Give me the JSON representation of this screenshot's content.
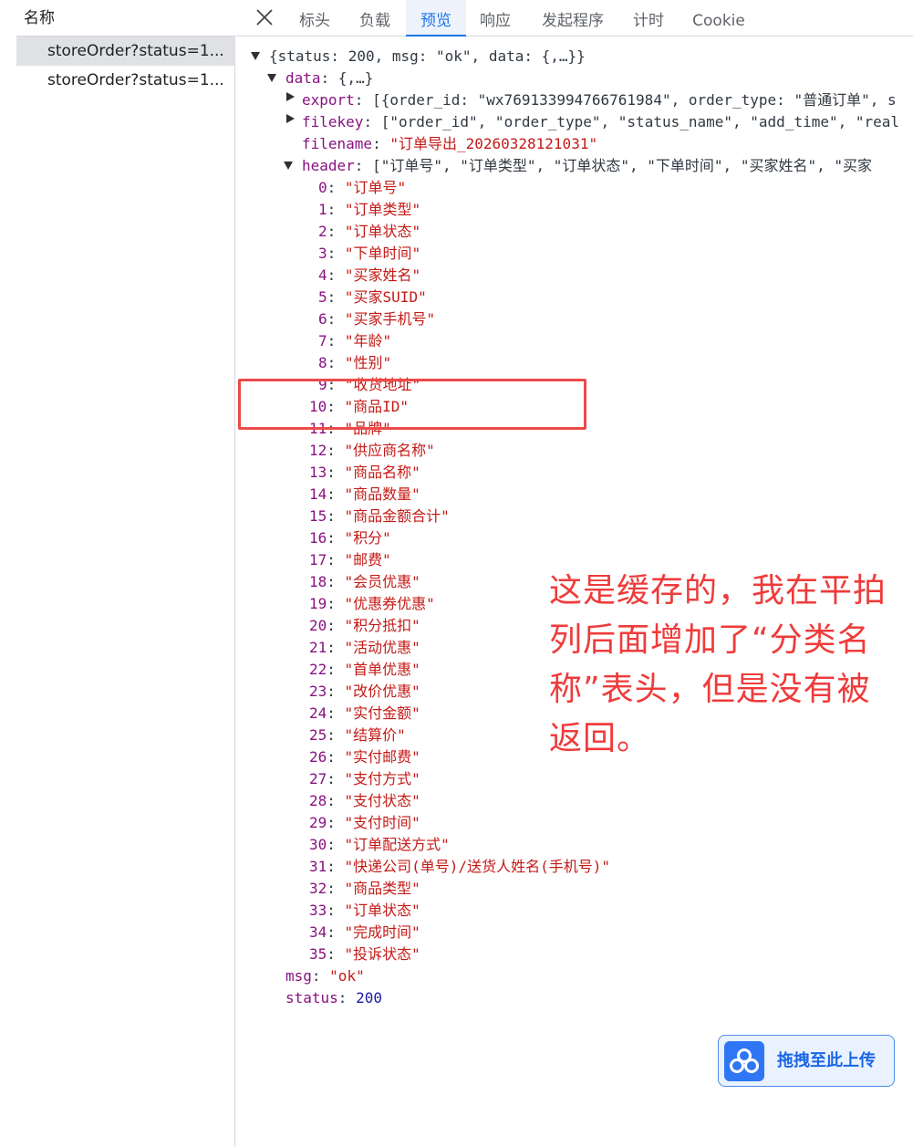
{
  "request_list": {
    "header": "名称",
    "items": [
      {
        "label": "storeOrder?status=1...",
        "selected": true
      },
      {
        "label": "storeOrder?status=1...",
        "selected": false
      }
    ]
  },
  "tabs": [
    "标头",
    "负载",
    "预览",
    "响应",
    "发起程序",
    "计时",
    "Cookie"
  ],
  "active_tab": "预览",
  "json": {
    "root_summary": "{status: 200, msg: \"ok\", data: {,…}}",
    "data_key": "data",
    "data_summary": "{,…}",
    "export_key": "export",
    "export_summary": "[{order_id: \"wx769133994766761984\", order_type: \"普通订单\", s",
    "filekey_key": "filekey",
    "filekey_summary": "[\"order_id\", \"order_type\", \"status_name\", \"add_time\", \"real",
    "filename_key": "filename",
    "filename_value": "\"订单导出_20260328121031\"",
    "header_key": "header",
    "header_summary": "[\"订单号\", \"订单类型\", \"订单状态\", \"下单时间\", \"买家姓名\", \"买家",
    "header_items": [
      "订单号",
      "订单类型",
      "订单状态",
      "下单时间",
      "买家姓名",
      "买家SUID",
      "买家手机号",
      "年龄",
      "性别",
      "收货地址",
      "商品ID",
      "品牌",
      "供应商名称",
      "商品名称",
      "商品数量",
      "商品金额合计",
      "积分",
      "邮费",
      "会员优惠",
      "优惠券优惠",
      "积分抵扣",
      "活动优惠",
      "首单优惠",
      "改价优惠",
      "实付金额",
      "结算价",
      "实付邮费",
      "支付方式",
      "支付状态",
      "支付时间",
      "订单配送方式",
      "快递公司(单号)/送货人姓名(手机号)",
      "商品类型",
      "订单状态",
      "完成时间",
      "投诉状态"
    ],
    "msg_key": "msg",
    "msg_value": "\"ok\"",
    "status_key": "status",
    "status_value": "200"
  },
  "annotation": {
    "lines": [
      "这是缓存的，我在平拍",
      "列后面增加了“分类名",
      "称”表头，但是没有被",
      "返回。"
    ],
    "color": "#ef3b3b"
  },
  "upload_button": {
    "label": "拖拽至此上传",
    "icon": "cloud-upload-icon"
  }
}
